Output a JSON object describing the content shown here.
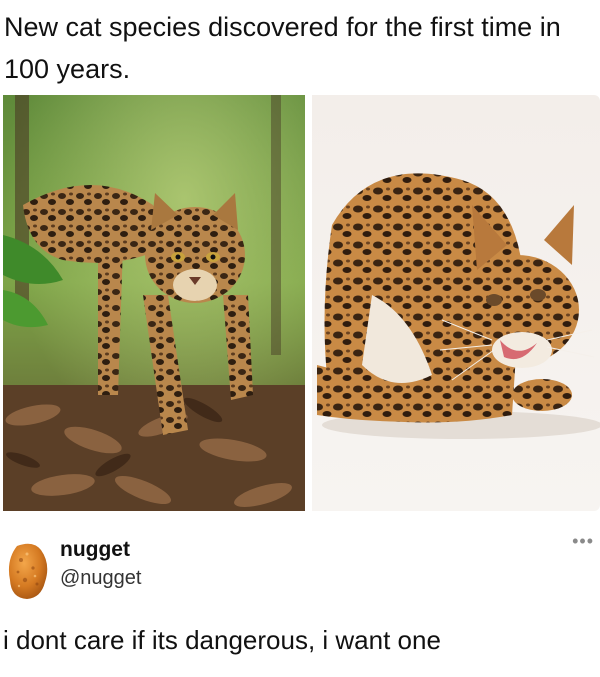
{
  "post": {
    "headline": "New cat species discovered for the first time in 100 years."
  },
  "images": [
    {
      "name": "ocelot-forest-photo"
    },
    {
      "name": "ocelot-studio-photo"
    }
  ],
  "tweet": {
    "display_name": "nugget",
    "handle": "@nugget",
    "text": "i dont care if its dangerous, i want one",
    "more_icon": "more-options-icon",
    "avatar_icon": "chicken-nugget-avatar"
  },
  "colors": {
    "text": "#111111",
    "handle": "#333333",
    "more": "#8a8a8a",
    "background": "#ffffff"
  }
}
